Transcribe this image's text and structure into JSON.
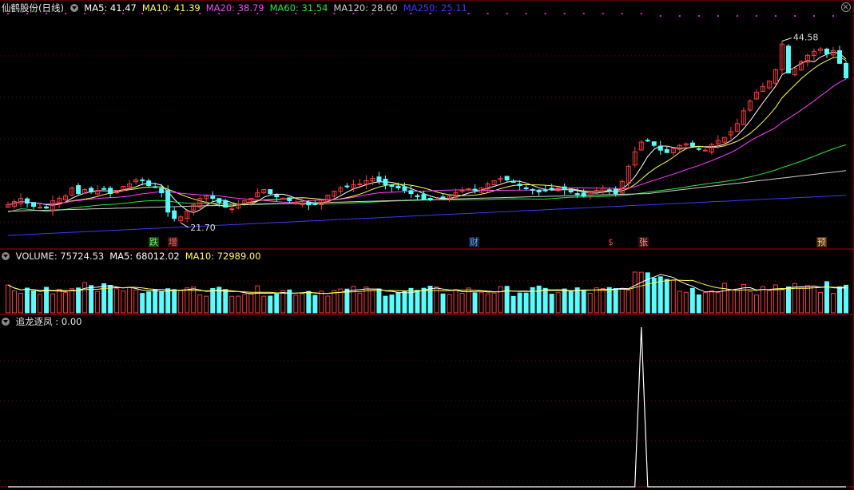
{
  "colors": {
    "up": "#ff3b3b",
    "down": "#54ffff",
    "ma5": "#ffffff",
    "ma10": "#ffff4b",
    "ma20": "#ff40ff",
    "ma60": "#29e63f",
    "ma120": "#d0d0d0",
    "ma250": "#3a3aff",
    "grid": "#7a0000",
    "axis": "#b00000"
  },
  "price_panel": {
    "title": "仙鹤股份(日线)",
    "ma_labels": [
      {
        "text": "MA5: 41.47",
        "color": "#ffffff"
      },
      {
        "text": "MA10: 41.39",
        "color": "#ffff4b"
      },
      {
        "text": "MA20: 38.79",
        "color": "#ff40ff"
      },
      {
        "text": "MA60: 31.54",
        "color": "#29e63f"
      },
      {
        "text": "MA120: 28.60",
        "color": "#d0d0d0"
      },
      {
        "text": "MA250: 25.11",
        "color": "#3a3aff"
      }
    ],
    "high_label": "44.58",
    "low_label": "21.70",
    "events": [
      {
        "text": "跌",
        "color": "#5aff5a",
        "bg": "#1a3a1a"
      },
      {
        "text": "增",
        "color": "#ff6a6a",
        "bg": "#3a1010"
      },
      {
        "text": "财",
        "color": "#5aaaff",
        "bg": "#10203a"
      },
      {
        "text": "$",
        "color": "#ff3b3b",
        "bg": "#000000"
      },
      {
        "text": "张",
        "color": "#ff9a9a",
        "bg": "#3a1010"
      },
      {
        "text": "预",
        "color": "#ffd28a",
        "bg": "#4a2a10"
      }
    ]
  },
  "volume_panel": {
    "labels": [
      {
        "text": "VOLUME: 75724.53",
        "color": "#e8e8e8"
      },
      {
        "text": "MA5: 68012.02",
        "color": "#ffffff"
      },
      {
        "text": "MA10: 72989.00",
        "color": "#ffff4b"
      }
    ]
  },
  "indicator_panel": {
    "labels": [
      {
        "text": "追龙逐凤 : 0.00",
        "color": "#e8e8e8"
      }
    ]
  },
  "chart_data": {
    "type": "candlestick",
    "title": "仙鹤股份(日线)",
    "price_range": [
      19.0,
      47.0
    ],
    "volume_range": [
      0,
      165000
    ],
    "indicator_range": [
      0,
      1
    ],
    "closes": [
      23.8,
      24.2,
      24.6,
      24.0,
      23.6,
      23.5,
      23.4,
      24.3,
      24.6,
      24.9,
      25.9,
      25.2,
      25.7,
      25.4,
      25.6,
      25.8,
      25.2,
      25.6,
      26.1,
      26.4,
      26.9,
      26.8,
      26.2,
      26.0,
      25.3,
      22.9,
      22.1,
      22.3,
      23.0,
      23.8,
      24.6,
      24.9,
      24.6,
      24.1,
      23.5,
      23.3,
      23.8,
      24.3,
      24.6,
      25.3,
      25.7,
      25.2,
      24.8,
      24.6,
      24.3,
      24.1,
      24.0,
      23.8,
      23.9,
      24.4,
      25.0,
      25.5,
      25.9,
      26.1,
      26.3,
      26.4,
      26.8,
      27.1,
      26.7,
      26.3,
      26.1,
      25.9,
      25.6,
      25.2,
      24.8,
      24.5,
      24.4,
      24.5,
      24.7,
      24.9,
      25.3,
      25.6,
      25.8,
      25.6,
      25.9,
      26.4,
      26.8,
      27.1,
      26.9,
      26.6,
      26.2,
      25.8,
      25.6,
      25.4,
      25.6,
      25.8,
      25.9,
      25.7,
      25.4,
      25.1,
      24.9,
      25.3,
      25.6,
      25.9,
      25.6,
      25.2,
      26.7,
      28.6,
      30.4,
      31.6,
      31.8,
      31.2,
      30.6,
      30.3,
      30.8,
      31.2,
      31.4,
      31.1,
      30.8,
      30.6,
      31.3,
      31.8,
      32.2,
      32.9,
      33.9,
      35.5,
      36.7,
      37.8,
      38.5,
      39.2,
      40.6,
      43.8,
      40.2,
      40.8,
      41.6,
      42.4,
      42.9,
      43.2,
      42.6,
      43.0,
      41.4,
      39.6
    ],
    "high_label_value": 44.58,
    "low_label_value": 21.7,
    "ma_current": {
      "MA5": 41.47,
      "MA10": 41.39,
      "MA20": 38.79,
      "MA60": 31.54,
      "MA120": 28.6,
      "MA250": 25.11
    },
    "volume_current": {
      "VOLUME": 75724.53,
      "MA5": 68012.02,
      "MA10": 72989.0
    },
    "indicator_name": "追龙逐凤",
    "indicator_value": 0.0
  }
}
